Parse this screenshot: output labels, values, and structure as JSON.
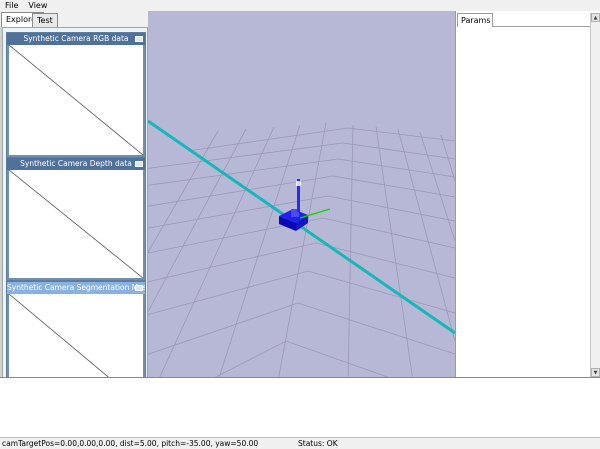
{
  "menu": [
    "File",
    "View"
  ],
  "left_tabs": [
    "Explorer",
    "Test"
  ],
  "camera_panels": [
    {
      "title": "Synthetic Camera RGB data"
    },
    {
      "title": "Synthetic Camera Depth data"
    },
    {
      "title": "Synthetic Camera Segmentation Mask",
      "selected": true
    }
  ],
  "params_tab": "Params",
  "statusbar": {
    "camera": "camTargetPos=0.00,0.00,0.00, dist=5.00, pitch=-35.00, yaw=50.00",
    "status": "Status: OK"
  },
  "colors": {
    "viewport_bg": "#b7b7d6",
    "grid_line": "#9a9ab5",
    "x_axis_line": "#14b8b8",
    "robot_blue": "#1010d8",
    "axis_green": "#00dd00"
  },
  "icons": {
    "collapse": "collapse-icon",
    "scroll_up": "scroll-up-arrow-icon",
    "scroll_down": "scroll-down-arrow-icon"
  }
}
